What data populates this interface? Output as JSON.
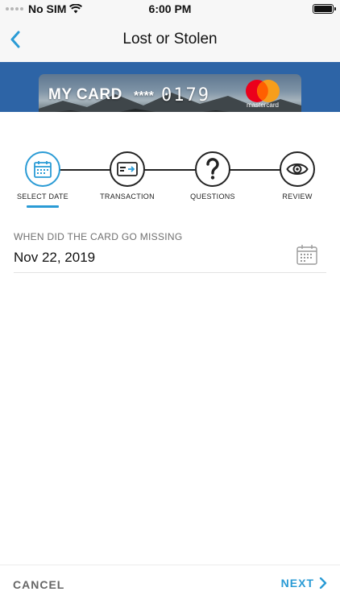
{
  "status_bar": {
    "carrier": "No SIM",
    "time": "6:00 PM",
    "icons": [
      "signal-dots-icon",
      "wifi-icon",
      "battery-icon"
    ]
  },
  "nav": {
    "title": "Lost or Stolen",
    "back_icon": "chevron-left-icon"
  },
  "card": {
    "name": "MY CARD",
    "mask": "****",
    "last4": "0179",
    "network": "mastercard"
  },
  "stepper": {
    "active_step": 0,
    "steps": [
      {
        "label": "SELECT DATE",
        "icon": "calendar-icon"
      },
      {
        "label": "TRANSACTION",
        "icon": "credit-card-icon"
      },
      {
        "label": "QUESTIONS",
        "icon": "question-mark-icon"
      },
      {
        "label": "REVIEW",
        "icon": "eye-icon"
      }
    ]
  },
  "date_field": {
    "label": "WHEN DID THE CARD GO MISSING",
    "value": "Nov 22, 2019",
    "icon": "calendar-icon"
  },
  "footer": {
    "cancel_label": "CANCEL",
    "next_label": "NEXT",
    "next_icon": "chevron-right-icon"
  },
  "colors": {
    "accent": "#2a9bd5",
    "banner": "#2d64a6",
    "mastercard_red": "#eb001b",
    "mastercard_orange": "#f79e1b"
  }
}
